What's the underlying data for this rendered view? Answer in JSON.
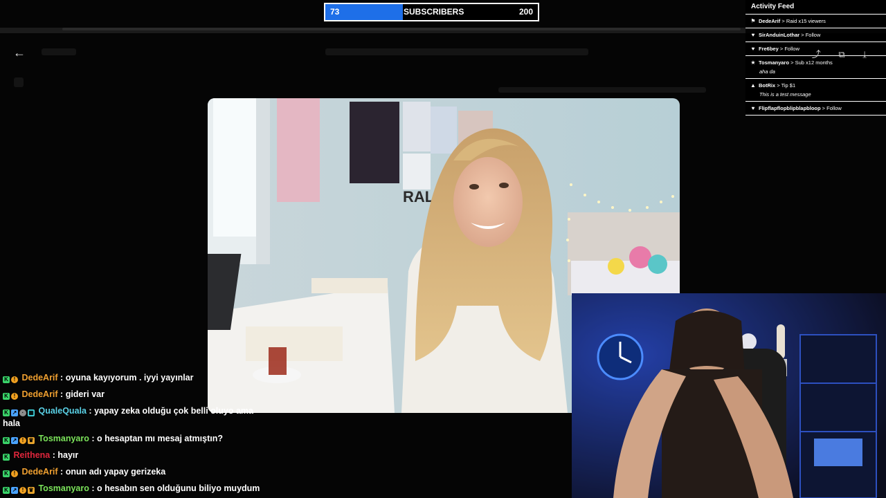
{
  "goal": {
    "current": "73",
    "label": "SUBSCRIBERS",
    "target": "200",
    "progress": 0.365,
    "fill_color": "#1e6fe8"
  },
  "feed": {
    "title": "Activity Feed",
    "items": [
      {
        "icon": "raid-icon",
        "user": "DedeArif",
        "action": "Raid x15 viewers",
        "message": ""
      },
      {
        "icon": "heart-icon",
        "user": "SirAnduinLothar",
        "action": "Follow",
        "message": ""
      },
      {
        "icon": "heart-icon",
        "user": "Fre6bey",
        "action": "Follow",
        "message": ""
      },
      {
        "icon": "star-icon",
        "user": "Tosmanyaro",
        "action": "Sub x12 months",
        "message": "aha da"
      },
      {
        "icon": "tip-icon",
        "user": "BotRix",
        "action": "Tip $1",
        "message": "This is a test message"
      },
      {
        "icon": "heart-icon",
        "user": "Flipflapflopblipblapbloop",
        "action": "Follow",
        "message": ""
      }
    ]
  },
  "chat": [
    {
      "user": "DedeArif",
      "color": "#f0a030",
      "badges": [
        "k",
        "sub"
      ],
      "text": "oyuna kayıyorum . iyyi yayınlar"
    },
    {
      "user": "DedeArif",
      "color": "#f0a030",
      "badges": [
        "k",
        "sub"
      ],
      "text": "gideri var"
    },
    {
      "user": "QualeQuala",
      "color": "#5ad1e6",
      "badges": [
        "k",
        "up",
        "ex",
        "pix"
      ],
      "text": "yapay zeka olduğu çok belli oluyo ama",
      "cont": "hala"
    },
    {
      "user": "Tosmanyaro",
      "color": "#7be35a",
      "badges": [
        "k",
        "up",
        "sub",
        "crown"
      ],
      "text": "o hesaptan mı mesaj atmıştın?"
    },
    {
      "user": "Reithena",
      "color": "#e0263c",
      "badges": [
        "k"
      ],
      "text": "hayır"
    },
    {
      "user": "DedeArif",
      "color": "#f0a030",
      "badges": [
        "k",
        "sub"
      ],
      "text": "onun adı yapay gerizeka"
    },
    {
      "user": "Tosmanyaro",
      "color": "#7be35a",
      "badges": [
        "k",
        "up",
        "sub",
        "crown"
      ],
      "text": "o hesabın sen olduğunu biliyo muydum"
    }
  ],
  "badge_glyphs": {
    "k": "K",
    "sub": "!",
    "up": "↗",
    "ex": "·",
    "pix": "▦",
    "crown": "♛"
  },
  "icons": {
    "back": "←",
    "share": "⤴",
    "copy": "⧉",
    "download": "⤓"
  }
}
